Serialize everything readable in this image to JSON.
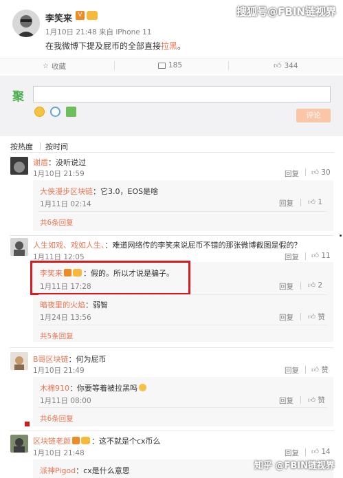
{
  "watermark_top": "搜狐号@FBIN链视界",
  "post": {
    "author": "李笑来",
    "time_source": "1月10日 21:48 来自 iPhone 11",
    "content_prefix": "在我微博下提及屁币的全部直接",
    "content_link": "拉黑",
    "content_suffix": "。"
  },
  "actions": {
    "favorite": "收藏",
    "comment_count": "185",
    "like_count": "344"
  },
  "composer": {
    "logo": "聚",
    "submit": "评论"
  },
  "sort": {
    "by_hot": "按热度",
    "by_time": "按时间"
  },
  "comments": [
    {
      "user": "谢盾",
      "text": "：没听说过",
      "time": "1月10日 21:59",
      "reply": "回复",
      "likes": "30"
    },
    {
      "user": "大侠漫步区块链",
      "text": "：它3.0，EOS是啥",
      "time": "1月11日 02:14",
      "reply": "回复",
      "likes": "1"
    },
    {
      "more": "共6条回复"
    },
    {
      "user": "人生如戏、戏如人生、",
      "text": "：难道网络传的李笑来说屁币不错的那张微博截图是假的？",
      "time": "1月11日 12:05",
      "reply": "回复",
      "likes": "11"
    },
    {
      "user": "李笑来",
      "text": "：假的。所以才说是骗子。",
      "time": "1月11日 17:28",
      "reply": "回复",
      "likes": "2"
    },
    {
      "user": "暗夜里的火焰",
      "text": "：弱智",
      "time": "1月24日 13:56",
      "reply": "回复",
      "likes": "赞"
    },
    {
      "more": "共5条回复"
    },
    {
      "user": "B哥区块链",
      "text": "：何为屁币",
      "time": "1月10日 21:49",
      "reply": "回复",
      "likes": "赞"
    },
    {
      "user": "木棉910",
      "text": "：你要等着被拉黑吗",
      "time": "1月11日 08:00",
      "reply": "回复",
      "likes": "赞"
    },
    {
      "more": "共6条回复"
    },
    {
      "user": "区块链老颜",
      "text": "：这不就是个cx币么",
      "time": "1月10日 21:48",
      "reply": "回复",
      "likes": "14"
    },
    {
      "user": "派神Pigod",
      "text": "：cx是什么意思"
    }
  ],
  "watermark_bottom": "知乎 @FBIN链视界"
}
